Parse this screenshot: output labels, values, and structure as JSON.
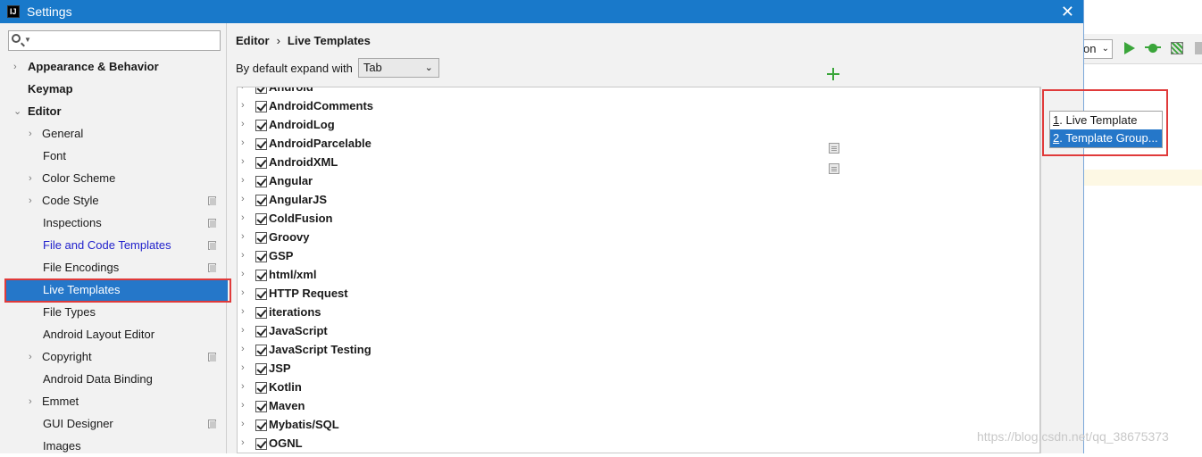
{
  "dialog": {
    "title": "Settings",
    "close_glyph": "✕",
    "app_icon_text": "IJ"
  },
  "search": {
    "placeholder": "",
    "value": ""
  },
  "sidebar": {
    "items": [
      {
        "label": "Appearance & Behavior",
        "arrow": "›",
        "bold": true
      },
      {
        "label": "Keymap",
        "bold": true
      },
      {
        "label": "Editor",
        "arrow": "⌄",
        "bold": true
      },
      {
        "label": "General",
        "arrow": "›"
      },
      {
        "label": "Font"
      },
      {
        "label": "Color Scheme",
        "arrow": "›"
      },
      {
        "label": "Code Style",
        "arrow": "›",
        "copy_icon": true
      },
      {
        "label": "Inspections",
        "copy_icon": true
      },
      {
        "label": "File and Code Templates",
        "copy_icon": true,
        "link": true
      },
      {
        "label": "File Encodings",
        "copy_icon": true
      },
      {
        "label": "Live Templates",
        "selected": true
      },
      {
        "label": "File Types"
      },
      {
        "label": "Android Layout Editor"
      },
      {
        "label": "Copyright",
        "arrow": "›",
        "copy_icon": true
      },
      {
        "label": "Android Data Binding"
      },
      {
        "label": "Emmet",
        "arrow": "›"
      },
      {
        "label": "GUI Designer",
        "copy_icon": true
      },
      {
        "label": "Images"
      }
    ]
  },
  "breadcrumb": {
    "parent": "Editor",
    "separator": "›",
    "current": "Live Templates"
  },
  "expand": {
    "label": "By default expand with",
    "value": "Tab",
    "chevron": "⌄"
  },
  "groups": [
    "Android",
    "AndroidComments",
    "AndroidLog",
    "AndroidParcelable",
    "AndroidXML",
    "Angular",
    "AngularJS",
    "ColdFusion",
    "Groovy",
    "GSP",
    "html/xml",
    "HTTP Request",
    "iterations",
    "JavaScript",
    "JavaScript Testing",
    "JSP",
    "Kotlin",
    "Maven",
    "Mybatis/SQL",
    "OGNL"
  ],
  "group_arrow": "›",
  "popup": {
    "items": [
      {
        "num": "1",
        "label": ". Live Template"
      },
      {
        "num": "2",
        "label": ". Template Group..."
      }
    ]
  },
  "background": {
    "combo_text": "on",
    "combo_chevron": "⌄",
    "watermark": "https://blog.csdn.net/qq_38675373"
  },
  "colors": {
    "titlebar": "#1979ca",
    "selection": "#2577c9",
    "highlight_box": "#e03a3a",
    "add_icon": "#3aa53a"
  }
}
